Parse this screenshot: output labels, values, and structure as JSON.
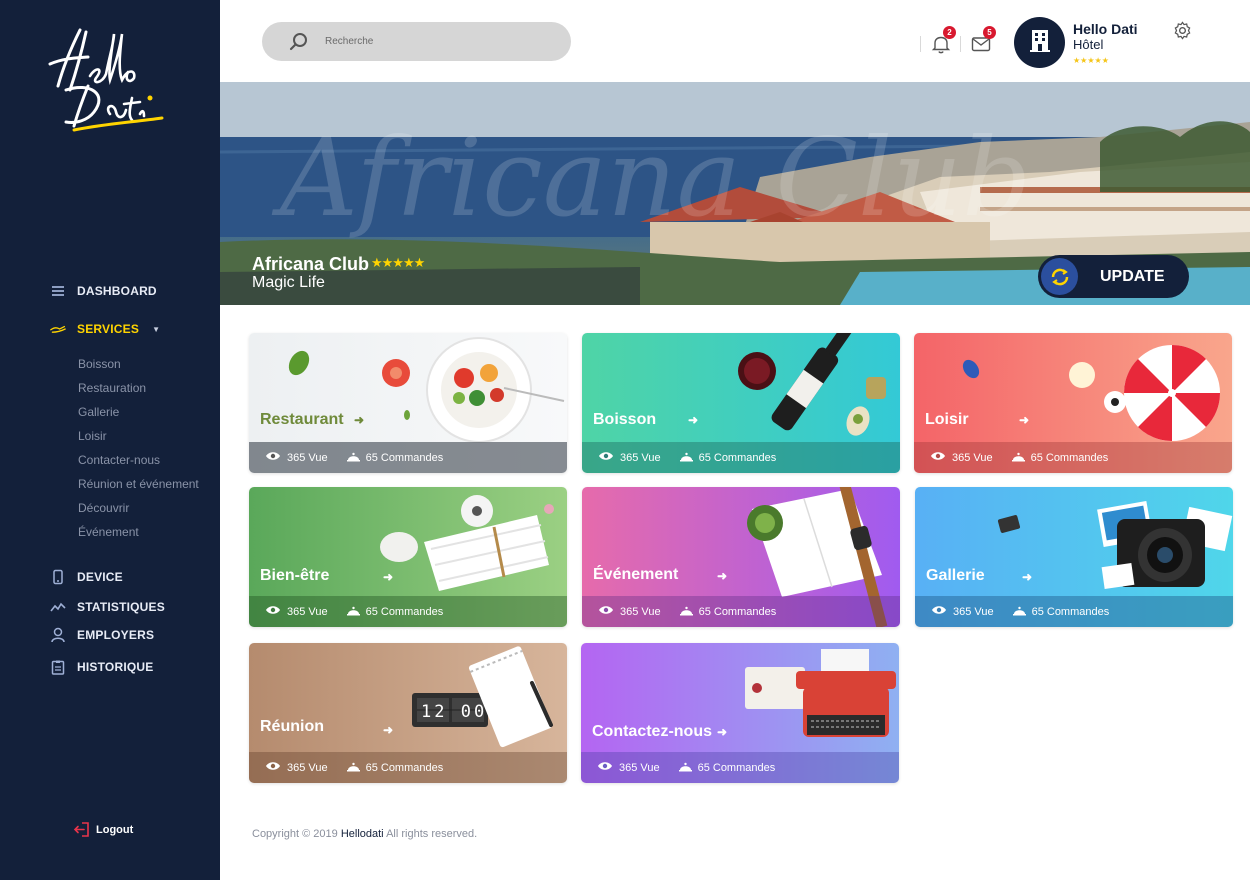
{
  "sidebar": {
    "logo_text": "Hello Dati",
    "nav": {
      "dashboard": "DASHBOARD",
      "services": "SERVICES",
      "device": "DEVICE",
      "statistiques": "STATISTIQUES",
      "employers": "EMPLOYERS",
      "historique": "HISTORIQUE"
    },
    "services_submenu": [
      "Boisson",
      "Restauration",
      "Gallerie",
      "Loisir",
      "Contacter-nous",
      "Réunion et événement",
      "Découvrir",
      "Événement"
    ],
    "logout": "Logout"
  },
  "topbar": {
    "search_placeholder": "Recherche",
    "notifications_count": "2",
    "messages_count": "5",
    "user_name": "Hello Dati",
    "user_type": "Hôtel",
    "user_stars": "★★★★★"
  },
  "banner": {
    "watermark": "Africana Club",
    "title": "Africana Club",
    "stars": "★★★★★",
    "subtitle": "Magic Life",
    "update_label": "UPDATE"
  },
  "cards": [
    {
      "title": "Restaurant",
      "views": "365 Vue",
      "orders": "65 Commandes",
      "color_start": "#eef1f3",
      "color_end": "#ffffff",
      "title_color": "#6f8a3a"
    },
    {
      "title": "Boisson",
      "views": "365 Vue",
      "orders": "65 Commandes",
      "color_start": "#4fd4a6",
      "color_end": "#33c9d6"
    },
    {
      "title": "Loisir",
      "views": "365 Vue",
      "orders": "65 Commandes",
      "color_start": "#f46468",
      "color_end": "#f9a68c"
    },
    {
      "title": "Bien-être",
      "views": "365 Vue",
      "orders": "65 Commandes",
      "color_start": "#5aa85a",
      "color_end": "#9bd083"
    },
    {
      "title": "Événement",
      "views": "365 Vue",
      "orders": "65 Commandes",
      "color_start": "#e66bab",
      "color_end": "#a05bf0"
    },
    {
      "title": "Gallerie",
      "views": "365 Vue",
      "orders": "65 Commandes",
      "color_start": "#58b0f5",
      "color_end": "#4fd6ea"
    },
    {
      "title": "Réunion",
      "views": "365 Vue",
      "orders": "65 Commandes",
      "color_start": "#b58b6e",
      "color_end": "#d7b59b"
    },
    {
      "title": "Contactez-nous",
      "views": "365 Vue",
      "orders": "65 Commandes",
      "color_start": "#b465f2",
      "color_end": "#8fb0f2"
    }
  ],
  "reunion_clock": "12 00",
  "footer": {
    "prefix": "Copyright © 2019",
    "brand": "Hellodati",
    "suffix": "All rights reserved."
  }
}
